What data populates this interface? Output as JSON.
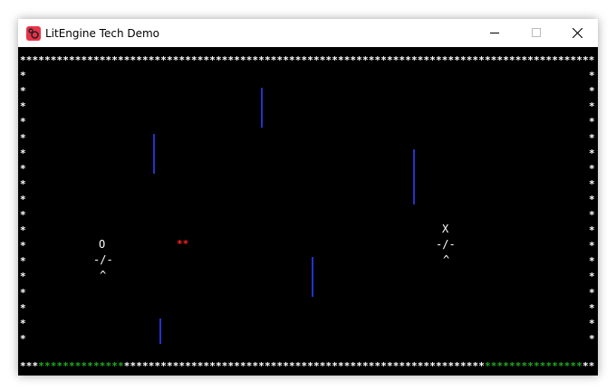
{
  "window": {
    "title": "LitEngine Tech Demo",
    "app_icon": "app-logo-icon",
    "controls": [
      "minimize-icon",
      "maximize-icon",
      "close-icon"
    ]
  },
  "game": {
    "border_char": "*",
    "colors": {
      "border": "#ffffff",
      "goal_zone": "#22aa22",
      "obstacle": "#2233cc",
      "ball": "#ff2222",
      "player": "#ffffff"
    },
    "player_left": {
      "head": "O",
      "body": "-/-",
      "legs": "^"
    },
    "player_right": {
      "head": "X",
      "body": "-/-",
      "legs": "^"
    },
    "ball": "**",
    "obstacle_char": "|"
  }
}
